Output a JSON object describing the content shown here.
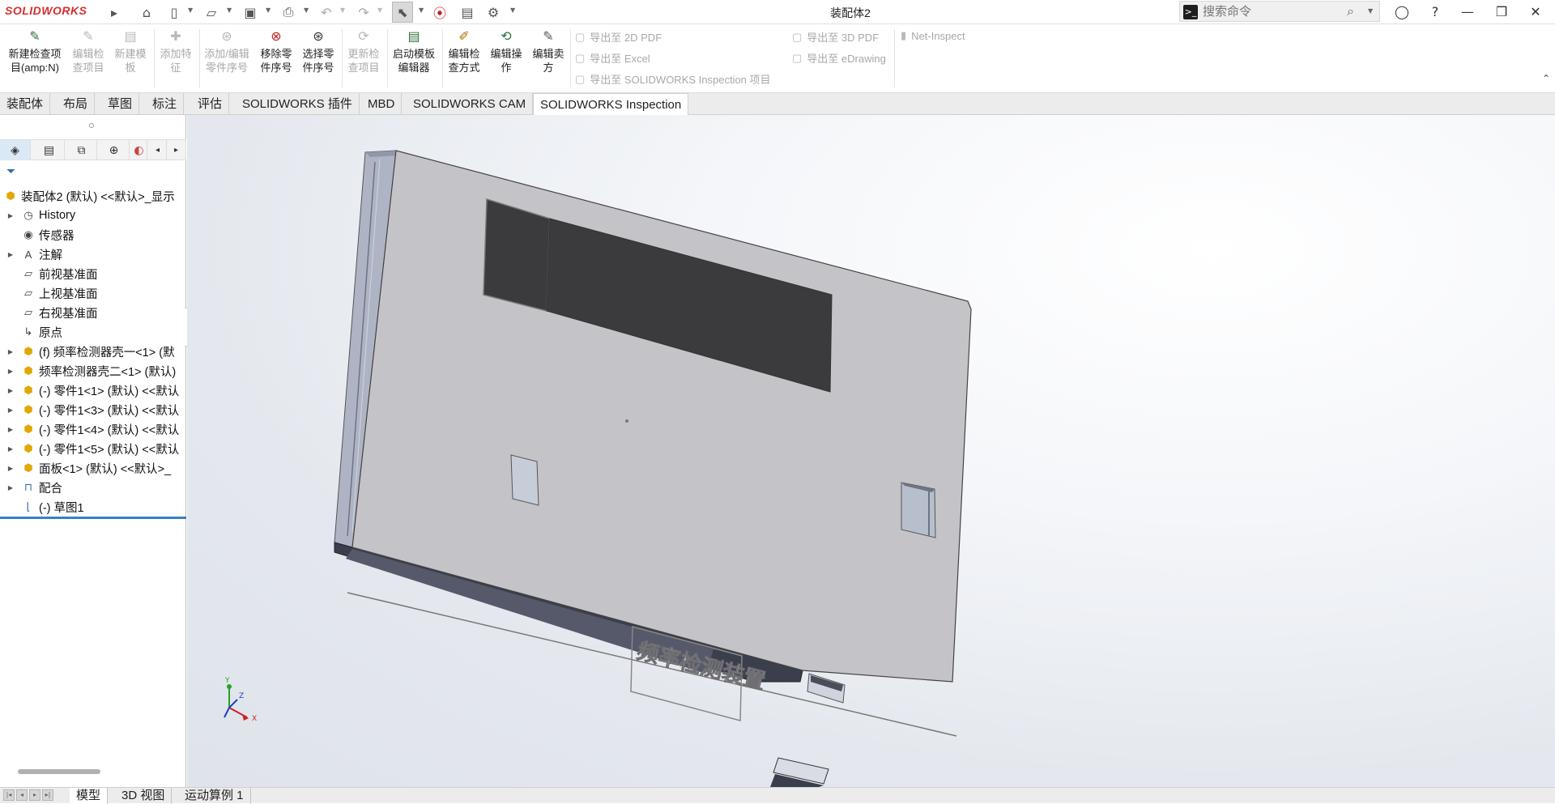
{
  "app": {
    "logo_text": "SOLIDWORKS",
    "document_title": "装配体2"
  },
  "search": {
    "placeholder": "搜索命令"
  },
  "ribbon": {
    "buttons": [
      {
        "label": "新建检查项\n目(amp:N)",
        "enabled": true
      },
      {
        "label": "编辑检\n查项目",
        "enabled": false
      },
      {
        "label": "新建模\n板",
        "enabled": false
      },
      {
        "label": "添加特\n征",
        "enabled": false
      },
      {
        "label": "添加/编辑\n零件序号",
        "enabled": false
      },
      {
        "label": "移除零\n件序号",
        "enabled": true
      },
      {
        "label": "选择零\n件序号",
        "enabled": true
      },
      {
        "label": "更新检\n查项目",
        "enabled": false
      },
      {
        "label": "启动模板\n编辑器",
        "enabled": true
      },
      {
        "label": "编辑检\n查方式",
        "enabled": true
      },
      {
        "label": "编辑操\n作",
        "enabled": true
      },
      {
        "label": "编辑卖\n方",
        "enabled": true
      }
    ],
    "export_2d_pdf": "导出至 2D PDF",
    "export_excel": "导出至 Excel",
    "export_inspection": "导出至 SOLIDWORKS Inspection 项目",
    "export_3d_pdf": "导出至 3D PDF",
    "export_edrawing": "导出至 eDrawing",
    "net_inspect": "Net-Inspect"
  },
  "tabs": [
    "装配体",
    "布局",
    "草图",
    "标注",
    "评估",
    "SOLIDWORKS 插件",
    "MBD",
    "SOLIDWORKS CAM",
    "SOLIDWORKS Inspection"
  ],
  "active_tab": "SOLIDWORKS Inspection",
  "tree": {
    "root": "装配体2 (默认) <<默认>_显示",
    "items": [
      {
        "label": "History",
        "icon": "history-icon"
      },
      {
        "label": "传感器",
        "icon": "sensor-icon"
      },
      {
        "label": "注解",
        "icon": "annotation-icon"
      },
      {
        "label": "前视基准面",
        "icon": "plane-icon"
      },
      {
        "label": "上视基准面",
        "icon": "plane-icon"
      },
      {
        "label": "右视基准面",
        "icon": "plane-icon"
      },
      {
        "label": "原点",
        "icon": "origin-icon"
      },
      {
        "label": "(f) 频率检测器壳一<1> (默",
        "icon": "part-icon"
      },
      {
        "label": "频率检测器壳二<1> (默认)",
        "icon": "part-icon"
      },
      {
        "label": "(-) 零件1<1> (默认) <<默认",
        "icon": "part-icon"
      },
      {
        "label": "(-) 零件1<3> (默认) <<默认",
        "icon": "part-icon"
      },
      {
        "label": "(-) 零件1<4> (默认) <<默认",
        "icon": "part-icon"
      },
      {
        "label": "(-) 零件1<5> (默认) <<默认",
        "icon": "part-icon"
      },
      {
        "label": "面板<1> (默认) <<默认>_",
        "icon": "part-icon"
      },
      {
        "label": "配合",
        "icon": "mate-icon"
      },
      {
        "label": "(-) 草图1",
        "icon": "sketch-icon"
      }
    ]
  },
  "bottom_tabs": [
    "模型",
    "3D 视图",
    "运动算例 1"
  ],
  "model": {
    "engraved_text": "频率检测装置"
  },
  "triad": {
    "x": "X",
    "y": "Y",
    "z": "Z"
  },
  "colors": {
    "brand": "#d32f2f",
    "accent": "#3a7fc2",
    "model_face": "#c4c4c8",
    "display_window": "#3b3b3d"
  }
}
